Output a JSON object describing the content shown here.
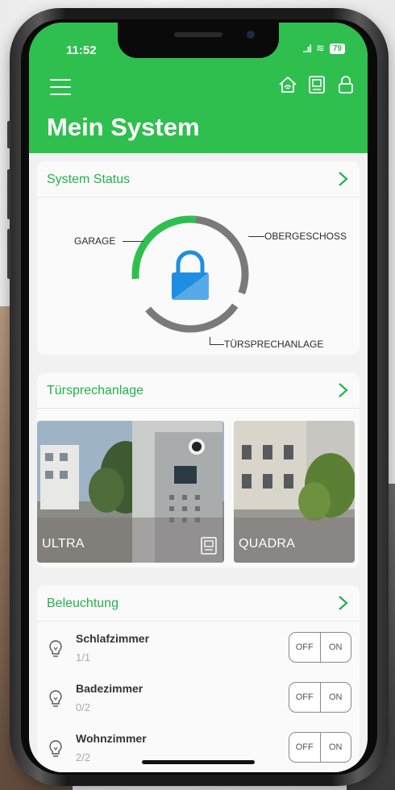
{
  "status_bar": {
    "time": "11:52",
    "signal": "..ıl",
    "wifi": "≋",
    "battery": "79"
  },
  "header": {
    "title": "Mein System",
    "icons": [
      "home-wifi-icon",
      "intercom-icon",
      "lock-icon"
    ]
  },
  "system_status": {
    "title": "System Status",
    "labels": {
      "garage": "GARAGE",
      "obergeschoss": "OBERGESCHOSS",
      "tuersprechanlage": "TÜRSPRECHANLAGE"
    },
    "colors": {
      "armed": "#2fbf4f",
      "disarmed": "#7a7a7a",
      "lock": "#1f8ee0"
    }
  },
  "intercom": {
    "title": "Türsprechanlage",
    "tiles": [
      {
        "label": "ULTRA"
      },
      {
        "label": "QUADRA"
      }
    ]
  },
  "lighting": {
    "title": "Beleuchtung",
    "rooms": [
      {
        "name": "Schlafzimmer",
        "count": "1/1",
        "off": "OFF",
        "on": "ON"
      },
      {
        "name": "Badezimmer",
        "count": "0/2",
        "off": "OFF",
        "on": "ON"
      },
      {
        "name": "Wohnzimmer",
        "count": "2/2",
        "off": "OFF",
        "on": "ON"
      }
    ]
  },
  "accent": "#2fbf4f"
}
